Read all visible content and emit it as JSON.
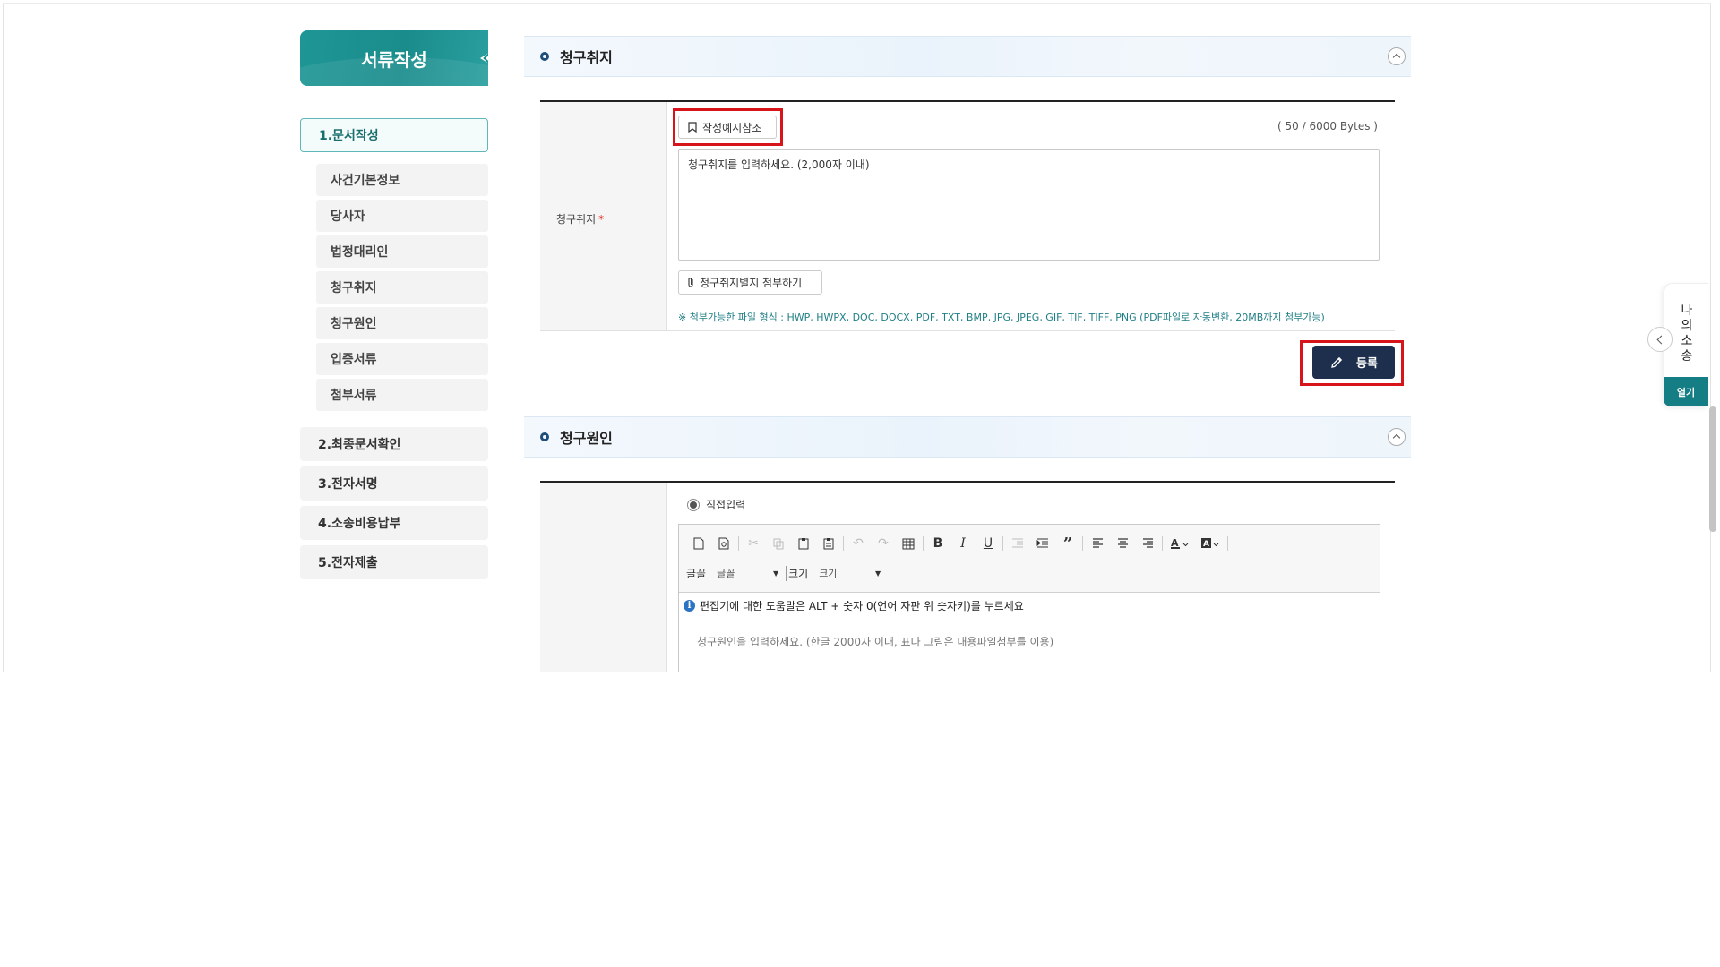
{
  "sidebar": {
    "header": "서류작성",
    "steps": [
      {
        "label": "1.문서작성"
      },
      {
        "label": "2.최종문서확인"
      },
      {
        "label": "3.전자서명"
      },
      {
        "label": "4.소송비용납부"
      },
      {
        "label": "5.전자제출"
      }
    ],
    "sub_items": [
      {
        "label": "사건기본정보"
      },
      {
        "label": "당사자"
      },
      {
        "label": "법정대리인"
      },
      {
        "label": "청구취지"
      },
      {
        "label": "청구원인"
      },
      {
        "label": "입증서류"
      },
      {
        "label": "첨부서류"
      }
    ]
  },
  "section1": {
    "title": "청구취지",
    "field_label": "청구취지",
    "required_mark": "*",
    "example_button": "작성예시참조",
    "byte_counter": "( 50 / 6000 Bytes )",
    "textarea_value": "청구취지를 입력하세요. (2,000자 이내)",
    "attach_button": "청구취지별지 첨부하기",
    "file_note": "※ 첨부가능한 파일 형식 : HWP, HWPX, DOC, DOCX, PDF, TXT, BMP, JPG, JPEG, GIF, TIF, TIFF, PNG (PDF파일로 자동변환, 20MB까지 첨부가능)",
    "register_button": "등록"
  },
  "section2": {
    "title": "청구원인",
    "radio_label": "직접입력",
    "toolbar": {
      "font_label": "글꼴",
      "font_value": "글꼴",
      "size_label": "크기",
      "size_value": "크기"
    },
    "help_text": "편집기에 대한 도움말은 ALT + 숫자 0(언어 자판 위 숫자키)를 누르세요",
    "placeholder": "청구원인을 입력하세요. (한글 2000자 이내, 표나 그림은 내용파일첨부를 이용)"
  },
  "float_panel": {
    "title": "나의소송",
    "open_button": "열기"
  },
  "colors": {
    "brand_teal": "#1a8c8c",
    "register_navy": "#1d2f4d",
    "highlight_red": "#d7141a",
    "note_teal": "#1f7f85"
  }
}
